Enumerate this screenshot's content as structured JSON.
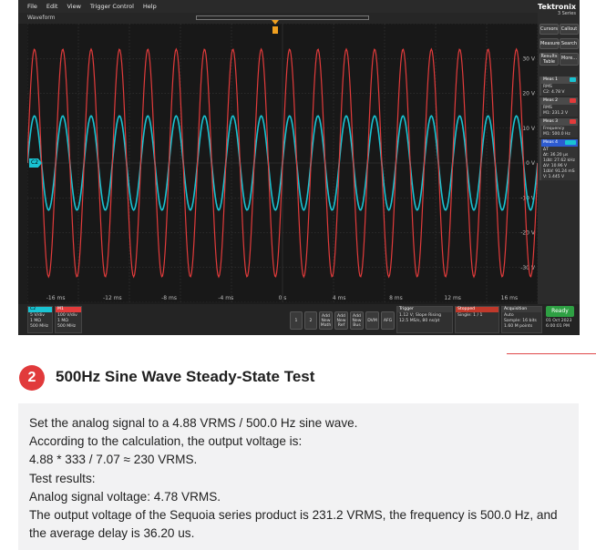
{
  "scope": {
    "menu": [
      "File",
      "Edit",
      "View",
      "Trigger Control",
      "Help"
    ],
    "window_title": "Waveform",
    "brand": {
      "name": "Tektronix",
      "series": "3 Series"
    },
    "panel_buttons": [
      "Cursors",
      "Callout",
      "Measure",
      "Search",
      "Results Table",
      "More..."
    ],
    "grid": {
      "x_ticks": [
        "-16 ms",
        "-12 ms",
        "-8 ms",
        "-4 ms",
        "0 s",
        "4 ms",
        "8 ms",
        "12 ms",
        "16 ms"
      ],
      "y_ticks": [
        "30 V",
        "20 V",
        "10 V",
        "0 V",
        "-10 V",
        "-20 V",
        "-30 V"
      ]
    },
    "channel_marker": "C2",
    "measurements": [
      {
        "title": "Meas 1",
        "tag": "C2",
        "lines": [
          "RMS",
          "C2: 4.78 V"
        ]
      },
      {
        "title": "Meas 2",
        "tag": "M1",
        "lines": [
          "RMS",
          "M1: 231.2 V"
        ]
      },
      {
        "title": "Meas 3",
        "tag": "M1",
        "lines": [
          "Frequency",
          "M1: 500.0 Hz"
        ]
      },
      {
        "title": "Meas 4",
        "tag": "C2 M1",
        "lines": [
          "ΔT",
          "Δt: 36.20 µs",
          "1/Δt: 27.62 kHz",
          "ΔV: 10.96 V",
          "1/ΔV: 91.24 mS",
          "V: 1.445 V"
        ]
      }
    ],
    "status": {
      "c2": {
        "label": "C2",
        "lines": [
          "5 V/div",
          "1 MΩ",
          "500 MHz"
        ]
      },
      "m1": {
        "label": "M1",
        "lines": [
          "100 V/div",
          "1 MΩ",
          "500 MHz"
        ]
      },
      "num_buttons": [
        "1",
        "2"
      ],
      "add_buttons": [
        "Add New Math",
        "Add New Ref",
        "Add New Bus"
      ],
      "tool_buttons": [
        "DVM",
        "AFG"
      ],
      "trigger": {
        "label": "Trigger",
        "lines": [
          "1.12 V; Slope",
          "Rising",
          "12.5 MS/s, 80 ns/pt"
        ]
      },
      "stopped": {
        "label": "Stopped",
        "lines": [
          "Single: 1 / 1"
        ]
      },
      "acquisition": {
        "label": "Acquisition",
        "lines": [
          "Auto",
          "Sample: 16 bits",
          "1.60 M points"
        ]
      },
      "ready": "Ready",
      "date": "01 Oct 2023",
      "time": "6:00:01 PM"
    },
    "colors": {
      "c2": "#19c3d2",
      "m1": "#e23b3b",
      "grid": "#3c3c3c"
    }
  },
  "chart_data": {
    "type": "line",
    "x_unit": "ms",
    "xlim": [
      -18,
      18
    ],
    "ylim": [
      -40,
      40
    ],
    "series": [
      {
        "name": "C2",
        "frequency_hz": 500,
        "amplitude_v": 6.76,
        "peak_v": 6.76,
        "rms_v": 4.78,
        "phase_deg": 0
      },
      {
        "name": "M1",
        "frequency_hz": 500,
        "amplitude_v": 327,
        "peak_v": 327,
        "rms_v": 231.2,
        "display_scale_v_per_div": 100,
        "phase_deg": 0
      }
    ]
  },
  "article": {
    "section_number": "2",
    "section_title": "500Hz Sine Wave Steady-State Test",
    "paragraphs": [
      "Set the analog signal to a 4.88 VRMS / 500.0 Hz sine wave.",
      "According to the calculation, the output voltage is:",
      "4.88 * 333 / 7.07 ≈ 230 VRMS.",
      "Test results:",
      "Analog signal voltage: 4.78 VRMS.",
      "The output voltage of the Sequoia series product is 231.2 VRMS, the frequency is 500.0 Hz, and the average delay is 36.20 us."
    ]
  }
}
